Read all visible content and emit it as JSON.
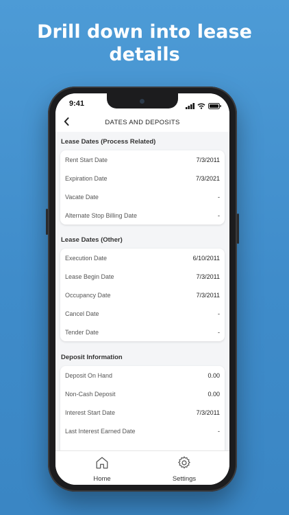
{
  "headline": {
    "line1": "Drill down into lease",
    "line2": "details"
  },
  "status_bar": {
    "time": "9:41",
    "icons": [
      "signal-icon",
      "wifi-icon",
      "battery-icon"
    ]
  },
  "nav": {
    "title": "DATES AND DEPOSITS",
    "back_icon": "chevron-left-icon"
  },
  "sections": [
    {
      "title": "Lease Dates (Process Related)",
      "rows": [
        {
          "label": "Rent Start Date",
          "value": "7/3/2011"
        },
        {
          "label": "Expiration Date",
          "value": "7/3/2021"
        },
        {
          "label": "Vacate Date",
          "value": "-"
        },
        {
          "label": "Alternate Stop Billing Date",
          "value": "-"
        }
      ]
    },
    {
      "title": "Lease Dates (Other)",
      "rows": [
        {
          "label": "Execution Date",
          "value": "6/10/2011"
        },
        {
          "label": "Lease Begin Date",
          "value": "7/3/2011"
        },
        {
          "label": "Occupancy Date",
          "value": "7/3/2011"
        },
        {
          "label": "Cancel Date",
          "value": "-"
        },
        {
          "label": "Tender Date",
          "value": "-"
        }
      ]
    },
    {
      "title": "Deposit Information",
      "rows": [
        {
          "label": "Deposit On Hand",
          "value": "0.00"
        },
        {
          "label": "Non-Cash Deposit",
          "value": "0.00"
        },
        {
          "label": "Interest Start Date",
          "value": "7/3/2011"
        },
        {
          "label": "Last Interest Earned Date",
          "value": "-"
        }
      ]
    }
  ],
  "tabbar": {
    "items": [
      {
        "label": "Home",
        "icon": "home-icon"
      },
      {
        "label": "Settings",
        "icon": "gear-icon"
      }
    ]
  },
  "colors": {
    "background": "#4393d0",
    "card": "#ffffff",
    "screen": "#f4f5f7"
  }
}
